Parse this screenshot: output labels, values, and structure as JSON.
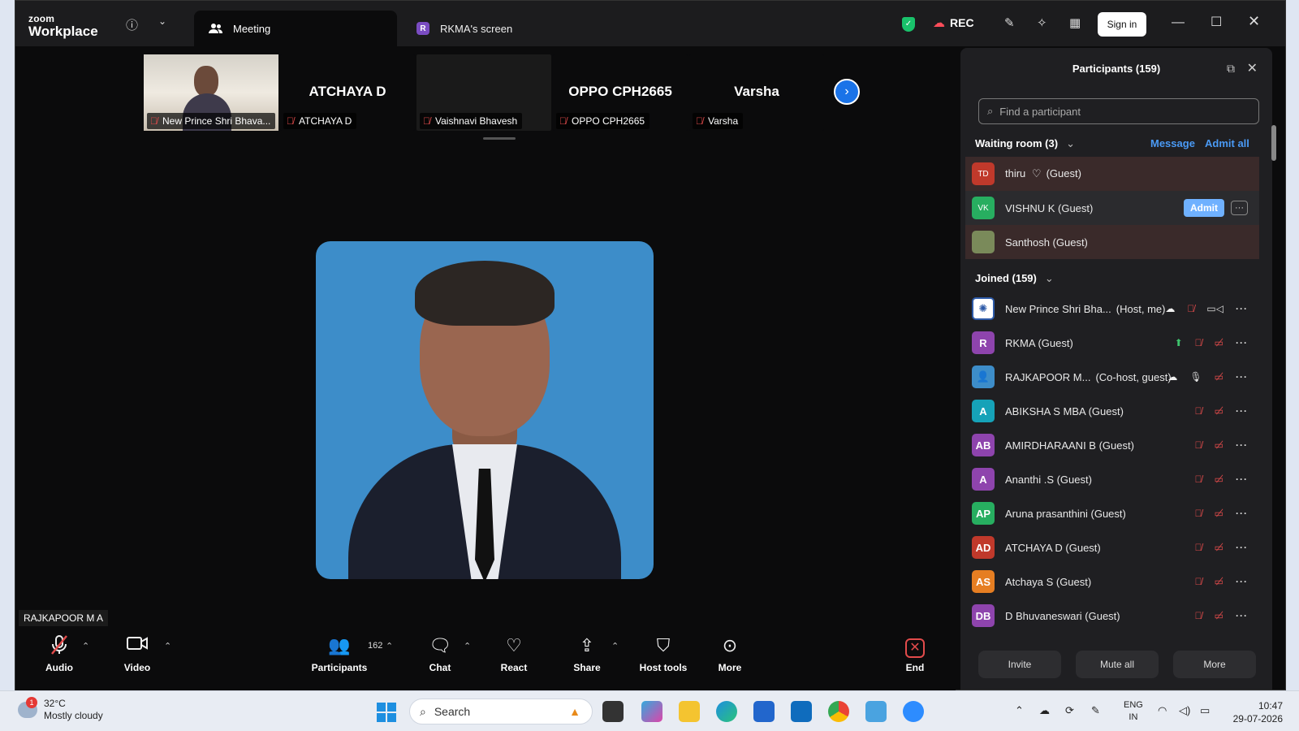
{
  "app": {
    "brand_small": "zoom",
    "brand_large": "Workplace",
    "tabs": [
      {
        "label": "Meeting",
        "icon": "people-icon"
      },
      {
        "label": "RKMA's screen",
        "icon": "R"
      }
    ],
    "rec_label": "REC",
    "sign_in_label": "Sign in"
  },
  "gallery": {
    "tiles": [
      {
        "name": "New Prince Shri Bhava...",
        "big": ""
      },
      {
        "name": "ATCHAYA D",
        "big": "ATCHAYA D"
      },
      {
        "name": "Vaishnavi Bhavesh",
        "big": ""
      },
      {
        "name": "OPPO CPH2665",
        "big": "OPPO CPH2665"
      },
      {
        "name": "Varsha",
        "big": "Varsha"
      }
    ]
  },
  "speaker": {
    "name": "RAJKAPOOR M A"
  },
  "toolbar": {
    "audio": "Audio",
    "video": "Video",
    "participants": "Participants",
    "participants_count": "162",
    "chat": "Chat",
    "react": "React",
    "share": "Share",
    "host_tools": "Host tools",
    "more": "More",
    "end": "End"
  },
  "panel": {
    "title": "Participants (159)",
    "search_placeholder": "Find a participant",
    "waiting_label": "Waiting room (3)",
    "message_label": "Message",
    "admit_all_label": "Admit all",
    "admit_label": "Admit",
    "joined_label": "Joined (159)",
    "waiting": [
      {
        "initials": "TD",
        "name": "thiru",
        "suffix": "(Guest)",
        "color": "#c0392b",
        "heart": true
      },
      {
        "initials": "VK",
        "name": "VISHNU K (Guest)",
        "suffix": "",
        "color": "#27ae60",
        "heart": false
      },
      {
        "initials": "",
        "name": "Santhosh (Guest)",
        "suffix": "",
        "color": "#7a8a5a",
        "heart": false
      }
    ],
    "joined": [
      {
        "initials": "",
        "name": "New Prince Shri Bha...",
        "suffix": "(Host, me)",
        "color": "#2d5aa8",
        "status": "host"
      },
      {
        "initials": "R",
        "name": "RKMA (Guest)",
        "suffix": "",
        "color": "#8e44ad",
        "status": "sharing"
      },
      {
        "initials": "",
        "name": "RAJKAPOOR M...",
        "suffix": "(Co-host, guest)",
        "color": "#3d8dc9",
        "status": "cohost"
      },
      {
        "initials": "A",
        "name": "ABIKSHA S MBA (Guest)",
        "suffix": "",
        "color": "#16a2b8",
        "status": "muted"
      },
      {
        "initials": "AB",
        "name": "AMIRDHARAANI B (Guest)",
        "suffix": "",
        "color": "#8e44ad",
        "status": "muted"
      },
      {
        "initials": "A",
        "name": "Ananthi .S (Guest)",
        "suffix": "",
        "color": "#8e44ad",
        "status": "muted"
      },
      {
        "initials": "AP",
        "name": "Aruna prasanthini (Guest)",
        "suffix": "",
        "color": "#27ae60",
        "status": "muted"
      },
      {
        "initials": "AD",
        "name": "ATCHAYA D (Guest)",
        "suffix": "",
        "color": "#c0392b",
        "status": "muted"
      },
      {
        "initials": "AS",
        "name": "Atchaya S (Guest)",
        "suffix": "",
        "color": "#e67e22",
        "status": "muted"
      },
      {
        "initials": "DB",
        "name": "D Bhuvaneswari (Guest)",
        "suffix": "",
        "color": "#8e44ad",
        "status": "muted"
      }
    ],
    "footer": {
      "invite": "Invite",
      "mute_all": "Mute all",
      "more": "More"
    }
  },
  "taskbar": {
    "weather_temp": "32°C",
    "weather_desc": "Mostly cloudy",
    "weather_badge": "1",
    "search_label": "Search",
    "lang_top": "ENG",
    "lang_bottom": "IN",
    "time": "10:47",
    "date": "29-07-2026"
  }
}
